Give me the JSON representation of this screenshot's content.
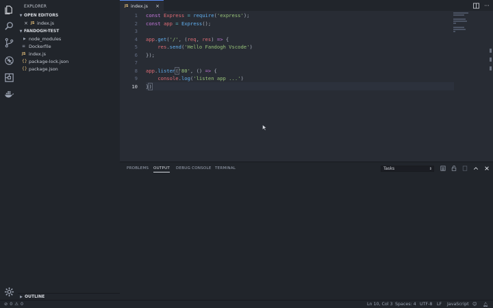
{
  "sidebar": {
    "title": "EXPLORER",
    "open_editors_header": "OPEN EDITORS",
    "open_editors": [
      {
        "badge": "JS",
        "label": "index.js"
      }
    ],
    "folder_header": "FANDOGH-TEST",
    "files": [
      {
        "kind": "folder",
        "label": "node_modules"
      },
      {
        "kind": "plain",
        "label": "Dockerfile"
      },
      {
        "kind": "js",
        "badge": "JS",
        "label": "index.js"
      },
      {
        "kind": "json",
        "badge": "{}",
        "label": "package-lock.json"
      },
      {
        "kind": "json",
        "badge": "{}",
        "label": "package.json"
      }
    ],
    "outline_header": "OUTLINE"
  },
  "tabs": [
    {
      "badge": "JS",
      "label": "index.js"
    }
  ],
  "editor": {
    "line_numbers": [
      "1",
      "2",
      "3",
      "4",
      "5",
      "6",
      "7",
      "8",
      "9",
      "10"
    ],
    "active_line": 10
  },
  "panel": {
    "tabs": [
      "PROBLEMS",
      "OUTPUT",
      "DEBUG CONSOLE",
      "TERMINAL"
    ],
    "active_tab": "OUTPUT",
    "task_select": "Tasks"
  },
  "status": {
    "errors": "0",
    "warnings": "0",
    "position": "Ln 10, Col 3",
    "spaces": "Spaces: 4",
    "encoding": "UTF-8",
    "eol": "LF",
    "language": "JavaScript"
  },
  "colors": {
    "background": "#282c34",
    "sidebar": "#21252b",
    "keyword": "#c678dd",
    "variable": "#e06c75",
    "function": "#61afef",
    "string": "#98c379",
    "accent": "#568af2"
  },
  "icons": {
    "activity": [
      "files-icon",
      "search-icon",
      "source-control-icon",
      "debug-icon",
      "extensions-icon",
      "docker-icon",
      "settings-gear-icon"
    ]
  }
}
